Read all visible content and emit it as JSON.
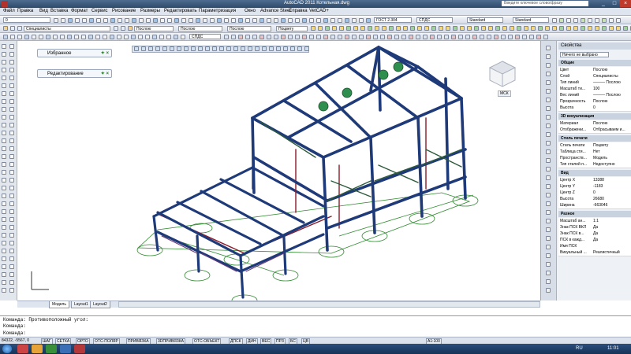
{
  "title": "AutoCAD 2011  Котельная.dwg",
  "help_search": "Введите ключевое слово/фразу",
  "menu": [
    "Файл",
    "Правка",
    "Вид",
    "Вставка",
    "Формат",
    "Сервис",
    "Рисование",
    "Размеры",
    "Редактировать",
    "Параметризация",
    "Окно",
    "Advance Steel",
    "Справка",
    "VetCAD+"
  ],
  "toolbar": {
    "layer_combo": "Специалисты",
    "color_combo": "Послою",
    "ltype_combo": "Послою",
    "lweight_combo": "Послою",
    "ucs_combo": "СПДС",
    "textstyle_combo": "ГОСТ 2.304",
    "dimstyle_combo": "СПДС",
    "tablestyle_combo": "Standard",
    "mleaderstyle_combo": "Standard",
    "plotstyle_combo": "Поцвету",
    "layer_top": "0"
  },
  "palettes": {
    "favorites": "Избранное",
    "edit": "Редактирование"
  },
  "viewcube": {
    "wcs": "МСК"
  },
  "properties": {
    "title": "Свойства",
    "selection": "Ничего не выбрано",
    "sections": [
      {
        "name": "Общие",
        "rows": [
          [
            "Цвет",
            "Послою"
          ],
          [
            "Слой",
            "Специалисты"
          ],
          [
            "Тип линий",
            "——— Послою"
          ],
          [
            "Масштаб ти...",
            "100"
          ],
          [
            "Вес линий",
            "——— Послою"
          ],
          [
            "Прозрачность",
            "Послою"
          ],
          [
            "Высота",
            "0"
          ]
        ]
      },
      {
        "name": "3D визуализация",
        "rows": [
          [
            "Материал",
            "Послою"
          ],
          [
            "Отображени...",
            "Отбрасываем и..."
          ]
        ]
      },
      {
        "name": "Стиль печати",
        "rows": [
          [
            "Стиль печати",
            "Поцвету"
          ],
          [
            "Таблица сти...",
            "Нет"
          ],
          [
            "Пространств...",
            "Модель"
          ],
          [
            "Тип стилей п...",
            "Недоступно"
          ]
        ]
      },
      {
        "name": "Вид",
        "rows": [
          [
            "Центр X",
            "13388"
          ],
          [
            "Центр Y",
            "-1183"
          ],
          [
            "Центр Z",
            "0"
          ],
          [
            "Высота",
            "26680"
          ],
          [
            "Ширина",
            "-663046"
          ]
        ]
      },
      {
        "name": "Разное",
        "rows": [
          [
            "Масштаб ан...",
            "1:1"
          ],
          [
            "Знак ПСК ВКЛ",
            "Да"
          ],
          [
            "Знак ПСК в...",
            "Да"
          ],
          [
            "ПСК в кажд...",
            "Да"
          ],
          [
            "Имя ПСК",
            ""
          ],
          [
            "Визуальный ...",
            "Реалистичный"
          ]
        ]
      }
    ]
  },
  "tabs": [
    "Модель",
    "Layout1",
    "Layout2"
  ],
  "command": {
    "lines": [
      "Команда: Противоположный угол:",
      "Команда:",
      "Команда:"
    ]
  },
  "status": {
    "coords": "84322, -5567, 0",
    "buttons": [
      "ШАГ",
      "СЕТКА",
      "ОРТО",
      "ОТС-ПОЛЯР",
      "ПРИВЯЗКА",
      "3DПРИВЯЗКА",
      "ОТС-ОБЪЕКТ",
      "ДПСК",
      "ДИН",
      "ВЕС",
      "ПРЗ",
      "БС",
      "ЦВ"
    ],
    "scale": "А1:100",
    "clock": "11:01",
    "lang": "RU"
  },
  "colors": {
    "steel": "#1f3a78",
    "edge": "#8a1b2a",
    "ground": "#2e8b2e",
    "bolt": "#2f8f4f"
  }
}
